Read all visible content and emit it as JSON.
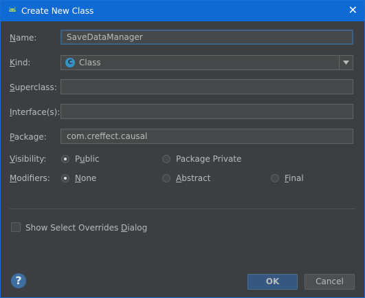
{
  "dialog": {
    "title": "Create New Class",
    "close_glyph": "✕"
  },
  "form": {
    "name_label_u": "N",
    "name_label_rest": "ame:",
    "name_value": "SaveDataManager",
    "kind_label_u": "K",
    "kind_label_rest": "ind:",
    "kind_icon_letter": "C",
    "kind_value": "Class",
    "superclass_label_u": "S",
    "superclass_label_rest": "uperclass:",
    "superclass_value": "",
    "interfaces_label_u": "I",
    "interfaces_label_rest": "nterface(s):",
    "interfaces_value": "",
    "package_label_u": "P",
    "package_label_rest": "ackage:",
    "package_value": "com.creffect.causal",
    "visibility_label_u": "V",
    "visibility_label_rest": "isibility:",
    "visibility_public_pre": "P",
    "visibility_public_u": "u",
    "visibility_public_post": "blic",
    "visibility_package_private": "Package Private",
    "visibility_selected": "Public",
    "modifiers_label_u": "M",
    "modifiers_label_rest": "odifiers:",
    "modifier_none_u": "N",
    "modifier_none_rest": "one",
    "modifier_abstract_u": "A",
    "modifier_abstract_rest": "bstract",
    "modifier_final_u": "F",
    "modifier_final_rest": "inal",
    "modifier_selected": "None"
  },
  "options": {
    "show_overrides_pre": "Show Select Overrides ",
    "show_overrides_u": "D",
    "show_overrides_post": "ialog",
    "show_overrides_checked": false
  },
  "buttons": {
    "ok": "OK",
    "cancel": "Cancel",
    "help_glyph": "?"
  },
  "colors": {
    "titlebar": "#0f6ad4",
    "background": "#3c3f41",
    "accent": "#365880"
  }
}
